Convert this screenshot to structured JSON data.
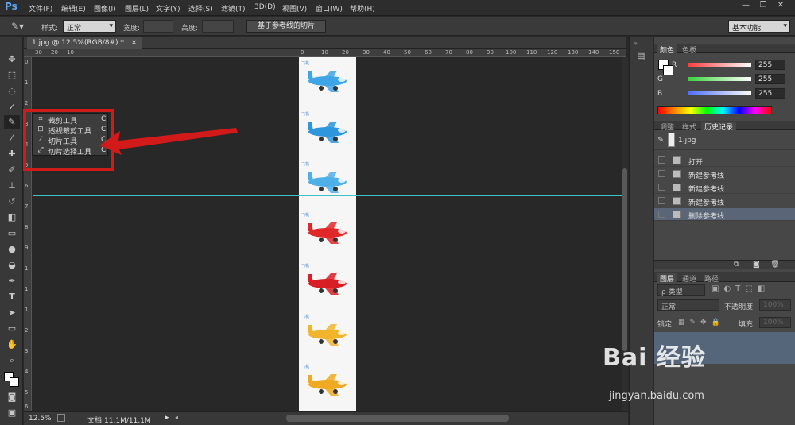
{
  "app": {
    "logo": "Ps"
  },
  "menu": [
    "文件(F)",
    "编辑(E)",
    "图像(I)",
    "图层(L)",
    "文字(Y)",
    "选择(S)",
    "滤镜(T)",
    "3D(D)",
    "视图(V)",
    "窗口(W)",
    "帮助(H)"
  ],
  "window_controls": [
    "—",
    "❐",
    "✕"
  ],
  "options": {
    "style_label": "样式:",
    "style_value": "正常",
    "width_label": "宽度:",
    "height_label": "高度:",
    "slice_button": "基于参考线的切片",
    "workspace": "基本功能"
  },
  "document": {
    "tab_title": "1.jpg @ 12.5%(RGB/8#) *",
    "tab_close": "×",
    "zoom": "12.5%",
    "doc_info": "文档:11.1M/11.1M",
    "image_label": "飞机",
    "planes": [
      {
        "color": "#3ea6e6"
      },
      {
        "color": "#2e96dc"
      },
      {
        "color": "#4fb0e8"
      },
      {
        "color": "#e02828"
      },
      {
        "color": "#d81e26"
      },
      {
        "color": "#f2b42a"
      },
      {
        "color": "#eeaa22"
      }
    ]
  },
  "rulers": {
    "top": [
      "30",
      "20",
      "10",
      "0",
      "10",
      "20",
      "30",
      "40",
      "50",
      "60",
      "70",
      "80",
      "90",
      "100",
      "110",
      "120",
      "130",
      "140",
      "150"
    ],
    "left": [
      "0",
      "1",
      "2",
      "3",
      "4",
      "5",
      "6",
      "7",
      "8",
      "9",
      "1",
      "1",
      "1",
      "2",
      "3",
      "4",
      "5",
      "6"
    ]
  },
  "flyout": {
    "items": [
      {
        "label": "裁剪工具",
        "key": "C",
        "icon": "crop-icon"
      },
      {
        "label": "透视裁剪工具",
        "key": "C",
        "icon": "perspective-crop-icon"
      },
      {
        "label": "切片工具",
        "key": "C",
        "icon": "slice-icon"
      },
      {
        "label": "切片选择工具",
        "key": "C",
        "icon": "slice-select-icon"
      }
    ]
  },
  "panels": {
    "color_tabs": [
      "颜色",
      "色板"
    ],
    "rgb": [
      {
        "label": "R",
        "value": "255",
        "color": "#ff3b3b"
      },
      {
        "label": "G",
        "value": "255",
        "color": "#39d339"
      },
      {
        "label": "B",
        "value": "255",
        "color": "#4c6cff"
      }
    ],
    "mid_tabs": [
      "调整",
      "样式",
      "历史记录"
    ],
    "history_snapshot": "1.jpg",
    "history": [
      "打开",
      "新建参考线",
      "新建参考线",
      "新建参考线",
      "删除参考线"
    ],
    "layer_tabs": [
      "图层",
      "通道",
      "路径"
    ],
    "layer_kind": "ρ 类型",
    "blend_mode": "正常",
    "opacity_label": "不透明度:",
    "opacity_value": "100%",
    "lock_label": "锁定:",
    "fill_label": "填充:",
    "fill_value": "100%"
  },
  "watermark": {
    "brand": "Bai 经验",
    "url": "jingyan.baidu.com"
  },
  "colors": {
    "accent": "#d21a1a",
    "guide": "#3fc1c8",
    "selected_history": "#5a6578"
  }
}
